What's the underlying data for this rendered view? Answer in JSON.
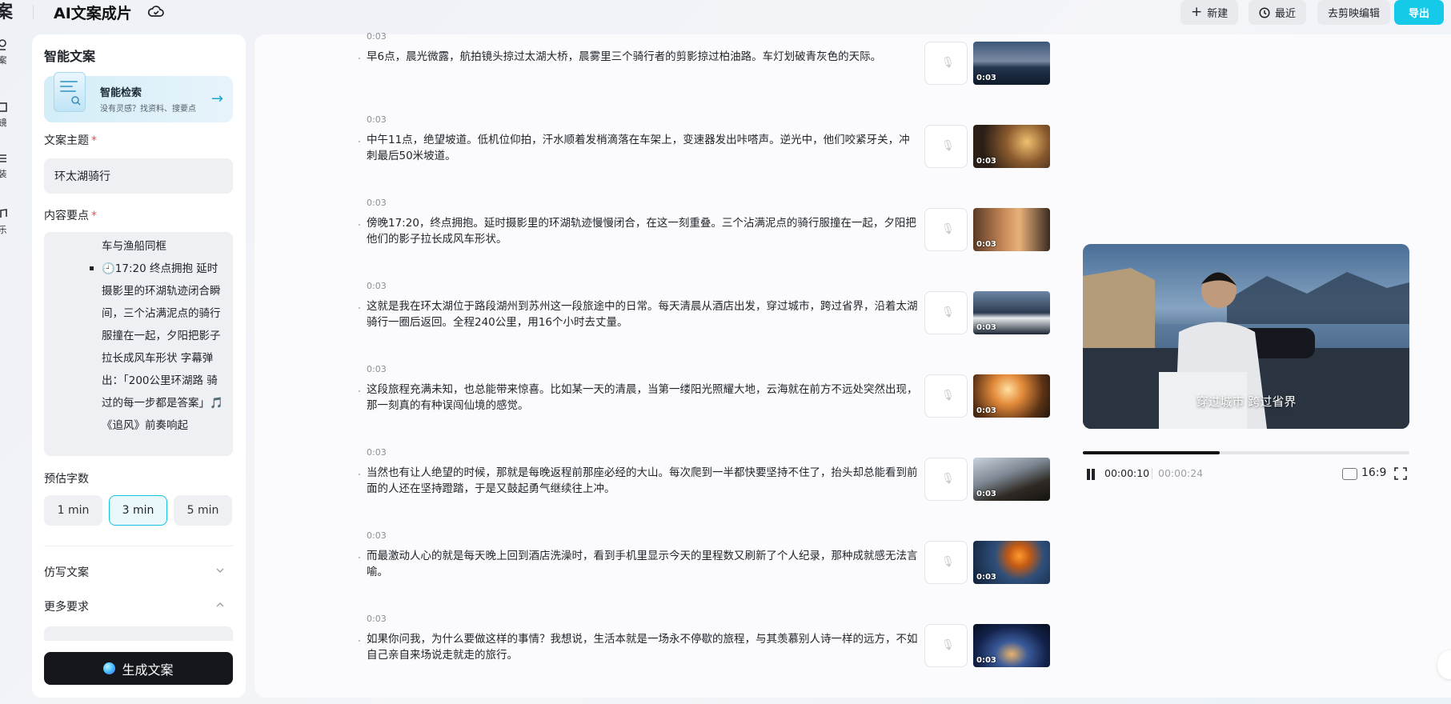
{
  "topbar": {
    "logo_glyph": "案",
    "title": "AI文案成片",
    "new_label": "新建",
    "recent_label": "最近",
    "jianying_label": "去剪映编辑",
    "export_label": "导出"
  },
  "rail": {
    "items": [
      "案",
      "镜",
      "装",
      "乐"
    ]
  },
  "left_panel": {
    "title": "智能文案",
    "search_card": {
      "title": "智能检索",
      "subtitle": "没有灵感？找资料、搜要点"
    },
    "topic_label": "文案主题",
    "topic_value": "环太湖骑行",
    "points_label": "内容要点",
    "points_text": "车与渔船同框\n🕘17:20 终点拥抱 延时摄影里的环湖轨迹闭合瞬间，三个沾满泥点的骑行服撞在一起，夕阳把影子拉长成风车形状 字幕弹出：「200公里环湖路 骑过的每一步都是答案」🎵《追风》前奏响起",
    "duration_label": "预估字数",
    "durations": [
      "1 min",
      "3 min",
      "5 min"
    ],
    "rewrite_label": "仿写文案",
    "more_label": "更多要求",
    "generate_label": "生成文案"
  },
  "segments": [
    {
      "time": "0:03",
      "text": "早6点，晨光微露，航拍镜头掠过太湖大桥，晨雾里三个骑行者的剪影掠过柏油路。车灯划破青灰色的天际。",
      "thumb_dur": "0:03"
    },
    {
      "time": "0:03",
      "text": "中午11点，绝望坡道。低机位仰拍，汗水顺着发梢滴落在车架上，变速器发出咔嗒声。逆光中，他们咬紧牙关，冲刺最后50米坡道。",
      "thumb_dur": "0:03"
    },
    {
      "time": "0:03",
      "text": "傍晚17:20，终点拥抱。延时摄影里的环湖轨迹慢慢闭合，在这一刻重叠。三个沾满泥点的骑行服撞在一起，夕阳把他们的影子拉长成风车形状。",
      "thumb_dur": "0:03"
    },
    {
      "time": "0:03",
      "text": "这就是我在环太湖位于路段湖州到苏州这一段旅途中的日常。每天清晨从酒店出发，穿过城市，跨过省界，沿着太湖骑行一圈后返回。全程240公里，用16个小时去丈量。",
      "thumb_dur": "0:03"
    },
    {
      "time": "0:03",
      "text": "这段旅程充满未知，也总能带来惊喜。比如某一天的清晨，当第一缕阳光照耀大地，云海就在前方不远处突然出现，那一刻真的有种误闯仙境的感觉。",
      "thumb_dur": "0:03"
    },
    {
      "time": "0:03",
      "text": "当然也有让人绝望的时候，那就是每晚返程前那座必经的大山。每次爬到一半都快要坚持不住了，抬头却总能看到前面的人还在坚持蹬踏，于是又鼓起勇气继续往上冲。",
      "thumb_dur": "0:03"
    },
    {
      "time": "0:03",
      "text": "而最激动人心的就是每天晚上回到酒店洗澡时，看到手机里显示今天的里程数又刷新了个人纪录，那种成就感无法言喻。",
      "thumb_dur": "0:03"
    },
    {
      "time": "0:03",
      "text": "如果你问我，为什么要做这样的事情？我想说，生活本就是一场永不停歇的旅程，与其羡慕别人诗一样的远方，不如自己亲自来场说走就走的旅行。",
      "thumb_dur": "0:03"
    }
  ],
  "preview": {
    "caption": "穿过城市 跨过省界",
    "current_time": "00:00:10",
    "total_time": "00:00:24",
    "progress": 0.42,
    "ratio": "16:9"
  },
  "colors": {
    "accent": "#15c9e8",
    "generate_bg": "#15171c"
  }
}
